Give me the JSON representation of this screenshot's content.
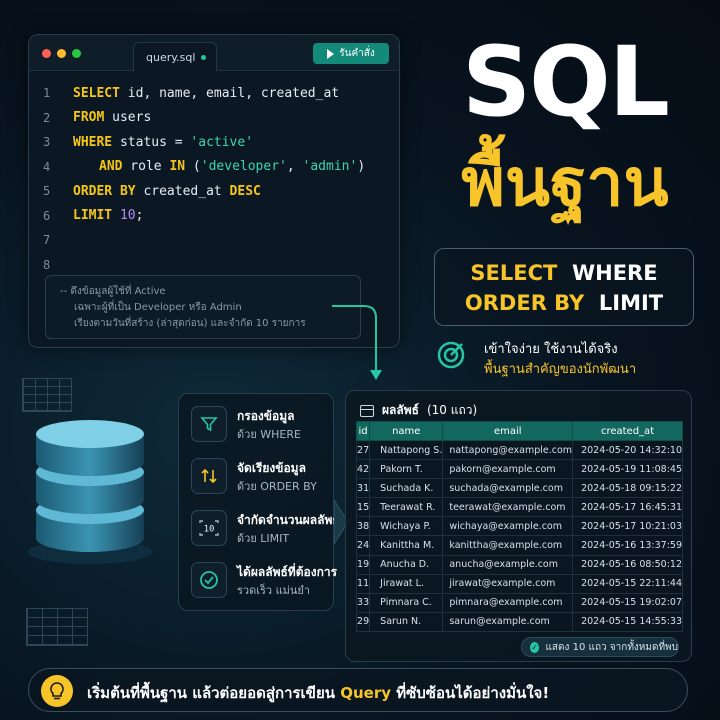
{
  "editor": {
    "tab_label": "query.sql",
    "run_label": "รันคำสั่ง",
    "lines": [
      {
        "n": "1"
      },
      {
        "n": "2"
      },
      {
        "n": "3"
      },
      {
        "n": "4"
      },
      {
        "n": "5"
      },
      {
        "n": "6"
      },
      {
        "n": "7"
      },
      {
        "n": "8"
      }
    ],
    "code": {
      "l1_kw": "SELECT",
      "l1_rest": " id, name, email, created_at",
      "l2_kw": "FROM",
      "l2_rest": " users",
      "l3_kw": "WHERE",
      "l3_rest": " status = ",
      "l3_str": "'active'",
      "l4_kw": "AND",
      "l4_mid": " role ",
      "l4_kw2": "IN",
      "l4_open": " (",
      "l4_str1": "'developer'",
      "l4_comma": ", ",
      "l4_str2": "'admin'",
      "l4_close": ")",
      "l5_kw": "ORDER BY",
      "l5_rest": " created_at ",
      "l5_kw2": "DESC",
      "l6_kw": "LIMIT",
      "l6_num": " 10",
      "l6_end": ";"
    },
    "comment": [
      "-- ดึงข้อมูลผู้ใช้ที่ Active",
      "เฉพาะผู้ที่เป็น Developer หรือ Admin",
      "เรียงตามวันที่สร้าง (ล่าสุดก่อน) และจำกัด 10 รายการ"
    ]
  },
  "hero": {
    "title": "SQL",
    "subtitle": "พื้นฐาน",
    "kw_select": "SELECT",
    "kw_where": "WHERE",
    "kw_order": "ORDER BY",
    "kw_limit": "LIMIT",
    "tagline1": "เข้าใจง่าย  ใช้งานได้จริง",
    "tagline2": "พื้นฐานสำคัญของนักพัฒนา"
  },
  "steps": [
    {
      "title": "กรองข้อมูล",
      "sub": "ด้วย WHERE",
      "icon": "filter-icon"
    },
    {
      "title": "จัดเรียงข้อมูล",
      "sub": "ด้วย ORDER BY",
      "icon": "sort-icon"
    },
    {
      "title": "จำกัดจำนวนผลลัพธ์",
      "sub": "ด้วย LIMIT",
      "icon": "limit-icon"
    },
    {
      "title": "ได้ผลลัพธ์ที่ต้องการ",
      "sub": "รวดเร็ว แม่นยำ",
      "icon": "check-circle-icon"
    }
  ],
  "results": {
    "title": "ผลลัพธ์",
    "count": "(10 แถว)",
    "columns": [
      "id",
      "name",
      "email",
      "created_at"
    ],
    "rows": [
      [
        "27",
        "Nattapong S.",
        "nattapong@example.com",
        "2024-05-20 14:32:10"
      ],
      [
        "42",
        "Pakorn T.",
        "pakorn@example.com",
        "2024-05-19 11:08:45"
      ],
      [
        "31",
        "Suchada K.",
        "suchada@example.com",
        "2024-05-18 09:15:22"
      ],
      [
        "15",
        "Teerawat R.",
        "teerawat@example.com",
        "2024-05-17 16:45:31"
      ],
      [
        "38",
        "Wichaya P.",
        "wichaya@example.com",
        "2024-05-17 10:21:03"
      ],
      [
        "24",
        "Kanittha M.",
        "kanittha@example.com",
        "2024-05-16 13:37:59"
      ],
      [
        "19",
        "Anucha D.",
        "anucha@example.com",
        "2024-05-16 08:50:12"
      ],
      [
        "11",
        "Jirawat L.",
        "jirawat@example.com",
        "2024-05-15 22:11:44"
      ],
      [
        "33",
        "Pimnara C.",
        "pimnara@example.com",
        "2024-05-15 19:02:07"
      ],
      [
        "29",
        "Sarun N.",
        "sarun@example.com",
        "2024-05-15 14:55:33"
      ]
    ],
    "footer": "แสดง 10 แถว จากทั้งหมดที่พบ"
  },
  "banner": {
    "part1": "เริ่มต้นที่พื้นฐาน  แล้วต่อยอดสู่การเขียน ",
    "highlight": "Query",
    "part2": " ที่ซับซ้อนได้อย่างมั่นใจ!"
  },
  "colors": {
    "accent_yellow": "#f7c42a",
    "accent_teal": "#26c6a2",
    "background": "#081420"
  }
}
